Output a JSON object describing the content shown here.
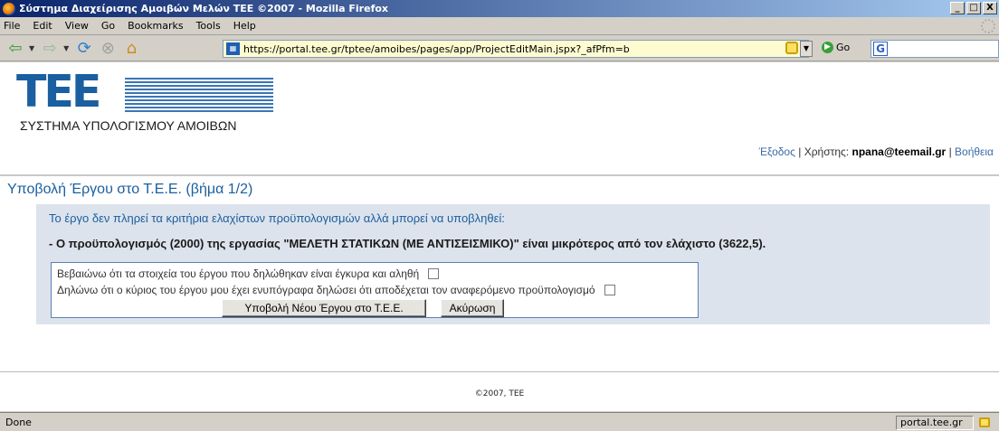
{
  "window": {
    "title": "Σύστημα Διαχείρισης Αμοιβών Μελών ΤΕΕ ©2007 - Mozilla Firefox",
    "controls": [
      "_",
      "□",
      "X"
    ]
  },
  "menu": [
    "File",
    "Edit",
    "View",
    "Go",
    "Bookmarks",
    "Tools",
    "Help"
  ],
  "toolbar": {
    "url": "https://portal.tee.gr/tptee/amoibes/pages/app/ProjectEditMain.jspx?_afPfm=b",
    "go_label": "Go"
  },
  "header": {
    "logo_text": "TEE",
    "subtitle": "ΣΥΣΤΗΜΑ ΥΠΟΛΟΓΙΣΜΟΥ ΑΜΟΙΒΩΝ",
    "logout": "Έξοδος",
    "user_label": "Χρήστης:",
    "user_email": "npana@teemail.gr",
    "help": "Βοήθεια"
  },
  "page": {
    "title": "Υποβολή Έργου στο Τ.Ε.Ε. (βήμα 1/2)",
    "message": "Το έργο δεν πληρεί τα κριτήρια ελαχίστων προϋπολογισμών αλλά μπορεί να υποβληθεί:",
    "detail": "- Ο προϋπολογισμός (2000) της εργασίας \"ΜΕΛΕΤΗ ΣΤΑΤΙΚΩΝ (ΜΕ ΑΝΤΙΣΕΙΣΜΙΚΟ)\" είναι μικρότερος από τον ελάχιστο (3622,5).",
    "confirm1": "Βεβαιώνω ότι τα στοιχεία του έργου που δηλώθηκαν είναι έγκυρα και αληθή",
    "confirm2": "Δηλώνω ότι ο κύριος του έργου μου έχει ενυπόγραφα δηλώσει ότι αποδέχεται τον αναφερόμενο προϋπολογισμό",
    "submit_label": "Υποβολή Νέου Έργου στο Τ.Ε.Ε.",
    "cancel_label": "Ακύρωση",
    "footer": "©2007, TEE"
  },
  "status": {
    "text": "Done",
    "host": "portal.tee.gr"
  }
}
